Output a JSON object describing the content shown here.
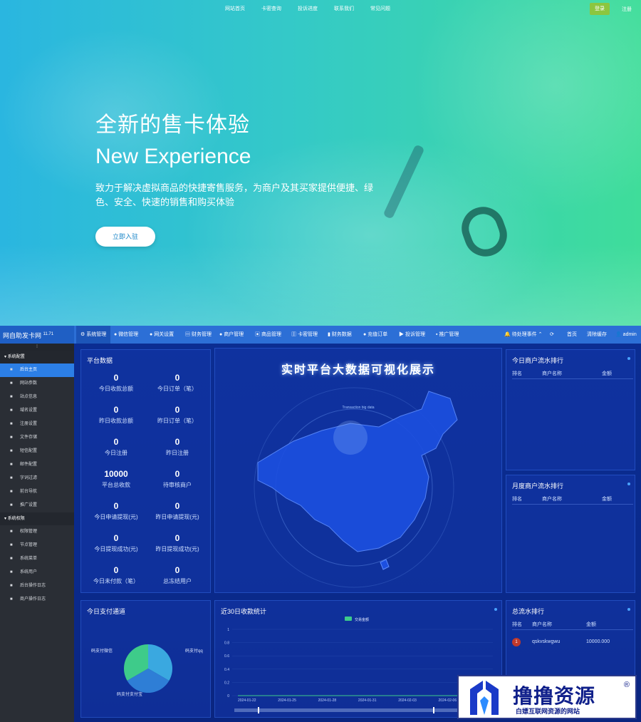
{
  "hero": {
    "nav": [
      "网站首页",
      "卡密查询",
      "投诉进度",
      "联系我们",
      "常见问题"
    ],
    "login": "登录",
    "register": "注册",
    "title_cn": "全新的售卡体验",
    "title_en": "New Experience",
    "desc": "致力于解决虚拟商品的快捷寄售服务，为商户及其买家提供便捷、绿色、安全、快速的销售和购买体验",
    "cta": "立即入驻"
  },
  "admin": {
    "brand": "网自助发卡网",
    "version": "11.71",
    "top_menu": [
      "系统管理",
      "微信管理",
      "网关设置",
      "财务管理",
      "商户管理",
      "商品管理",
      "卡密管理",
      "财务数据",
      "充值订单",
      "投诉管理",
      "推广管理"
    ],
    "top_right": [
      "待处理事件",
      "首页",
      "清除缓存",
      "admin"
    ],
    "sidebar": {
      "group1": "系统配置",
      "items1": [
        {
          "icon": "chart-icon",
          "label": "后台主页",
          "active": true
        },
        {
          "icon": "apple-icon",
          "label": "网站参数"
        },
        {
          "icon": "info-icon",
          "label": "站点信息"
        },
        {
          "icon": "globe-icon",
          "label": "域名设置"
        },
        {
          "icon": "gear-icon",
          "label": "注册设置"
        },
        {
          "icon": "save-icon",
          "label": "文件存储"
        },
        {
          "icon": "mail-icon",
          "label": "短信配置"
        },
        {
          "icon": "envelope-icon",
          "label": "邮件配置"
        },
        {
          "icon": "filter-icon",
          "label": "字词过滤"
        },
        {
          "icon": "image-icon",
          "label": "前台导航"
        },
        {
          "icon": "megaphone-icon",
          "label": "推广设置"
        }
      ],
      "group2": "系统权限",
      "items2": [
        {
          "icon": "lock-icon",
          "label": "权限管理"
        },
        {
          "icon": "node-icon",
          "label": "节点管理"
        },
        {
          "icon": "list-icon",
          "label": "系统菜单"
        },
        {
          "icon": "users-icon",
          "label": "系统用户"
        },
        {
          "icon": "terminal-icon",
          "label": "后台操作日志"
        },
        {
          "icon": "pin-icon",
          "label": "商户操作日志"
        }
      ]
    },
    "platform": {
      "title": "平台数据",
      "stats": [
        {
          "v": "0",
          "l": "今日收款总额"
        },
        {
          "v": "0",
          "l": "今日订单（笔）"
        },
        {
          "v": "0",
          "l": "昨日收款总额"
        },
        {
          "v": "0",
          "l": "昨日订单（笔）"
        },
        {
          "v": "0",
          "l": "今日注册"
        },
        {
          "v": "0",
          "l": "昨日注册"
        },
        {
          "v": "10000",
          "l": "平台总收款"
        },
        {
          "v": "0",
          "l": "待审核商户"
        },
        {
          "v": "0",
          "l": "今日申请提现(元)"
        },
        {
          "v": "0",
          "l": "昨日申请提现(元)"
        },
        {
          "v": "0",
          "l": "今日提现成功(元)"
        },
        {
          "v": "0",
          "l": "昨日提现成功(元)"
        },
        {
          "v": "0",
          "l": "今日未付款（笔）"
        },
        {
          "v": "0",
          "l": "总冻结用户"
        }
      ]
    },
    "center": {
      "title": "实时平台大数据可视化展示",
      "subtitle": "Transaction big data"
    },
    "today_rank": {
      "title": "今日商户流水排行",
      "cols": [
        "排名",
        "商户名称",
        "金额"
      ]
    },
    "month_rank": {
      "title": "月度商户流水排行",
      "cols": [
        "排名",
        "商户名称",
        "金额"
      ]
    },
    "total_rank": {
      "title": "总流水排行",
      "cols": [
        "排名",
        "商户名称",
        "金额"
      ],
      "rows": [
        {
          "name": "qskvskwgwu",
          "amount": "10000.000"
        }
      ]
    },
    "pay_channel": {
      "title": "今日支付通道",
      "labels": [
        "码支付微信",
        "码支付qq",
        "码支付支付宝"
      ]
    },
    "income30": {
      "title": "近30日收款统计",
      "legend": "交易金额"
    }
  },
  "chart_data": [
    {
      "type": "pie",
      "title": "今日支付通道",
      "labels": [
        "码支付微信",
        "码支付qq",
        "码支付支付宝"
      ],
      "values": [
        1,
        1,
        1
      ],
      "colors": [
        "#3ecb8a",
        "#3aa8e0",
        "#2e7ed6"
      ]
    },
    {
      "type": "line",
      "title": "近30日收款统计",
      "x": [
        "2024-01-22",
        "2024-01-25",
        "2024-01-28",
        "2024-01-31",
        "2024-02-03",
        "2024-02-06",
        "2024-0"
      ],
      "series": [
        {
          "name": "交易金额",
          "values": [
            0,
            0,
            0,
            0,
            0,
            0,
            0
          ]
        }
      ],
      "y_ticks": [
        "1",
        "0.8",
        "0.6",
        "0.4",
        "0.2",
        "0"
      ],
      "ylim": [
        0,
        1
      ]
    }
  ],
  "watermark": {
    "t1": "撸撸资源",
    "t2": "白嫖互联网资源的网站",
    "r": "®"
  }
}
